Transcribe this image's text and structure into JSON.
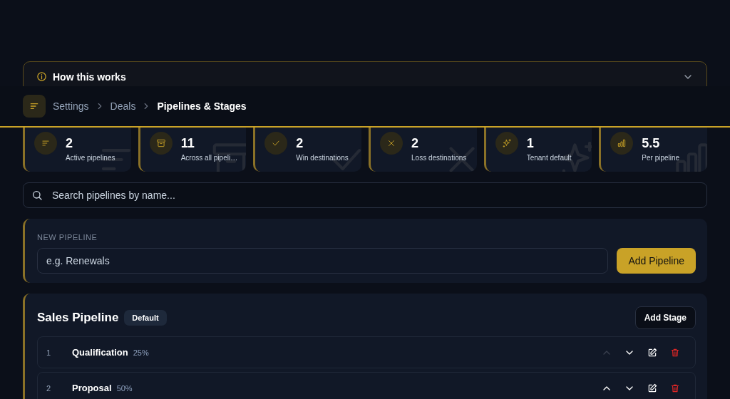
{
  "help_panel": {
    "title": "How this works"
  },
  "breadcrumb": [
    {
      "label": "Settings",
      "current": false
    },
    {
      "label": "Deals",
      "current": false
    },
    {
      "label": "Pipelines & Stages",
      "current": true
    }
  ],
  "stats": [
    {
      "kind": "lines",
      "value": "2",
      "label": "Active pipelines"
    },
    {
      "kind": "archive",
      "value": "11",
      "label": "Across all pipeli…"
    },
    {
      "kind": "check",
      "value": "2",
      "label": "Win destinations"
    },
    {
      "kind": "cross",
      "value": "2",
      "label": "Loss destinations"
    },
    {
      "kind": "sparkles",
      "value": "1",
      "label": "Tenant default"
    },
    {
      "kind": "bars",
      "value": "5.5",
      "label": "Per pipeline"
    }
  ],
  "search": {
    "placeholder": "Search pipelines by name..."
  },
  "new_pipeline": {
    "label": "NEW PIPELINE",
    "placeholder": "e.g. Renewals",
    "button": "Add Pipeline"
  },
  "pipelines": [
    {
      "name": "Sales Pipeline",
      "badge": "Default",
      "add_button": "Add Stage",
      "stages": [
        {
          "number": "1",
          "name": "Qualification",
          "probability": "25%",
          "up_disabled": true
        },
        {
          "number": "2",
          "name": "Proposal",
          "probability": "50%",
          "up_disabled": false
        }
      ]
    }
  ]
}
